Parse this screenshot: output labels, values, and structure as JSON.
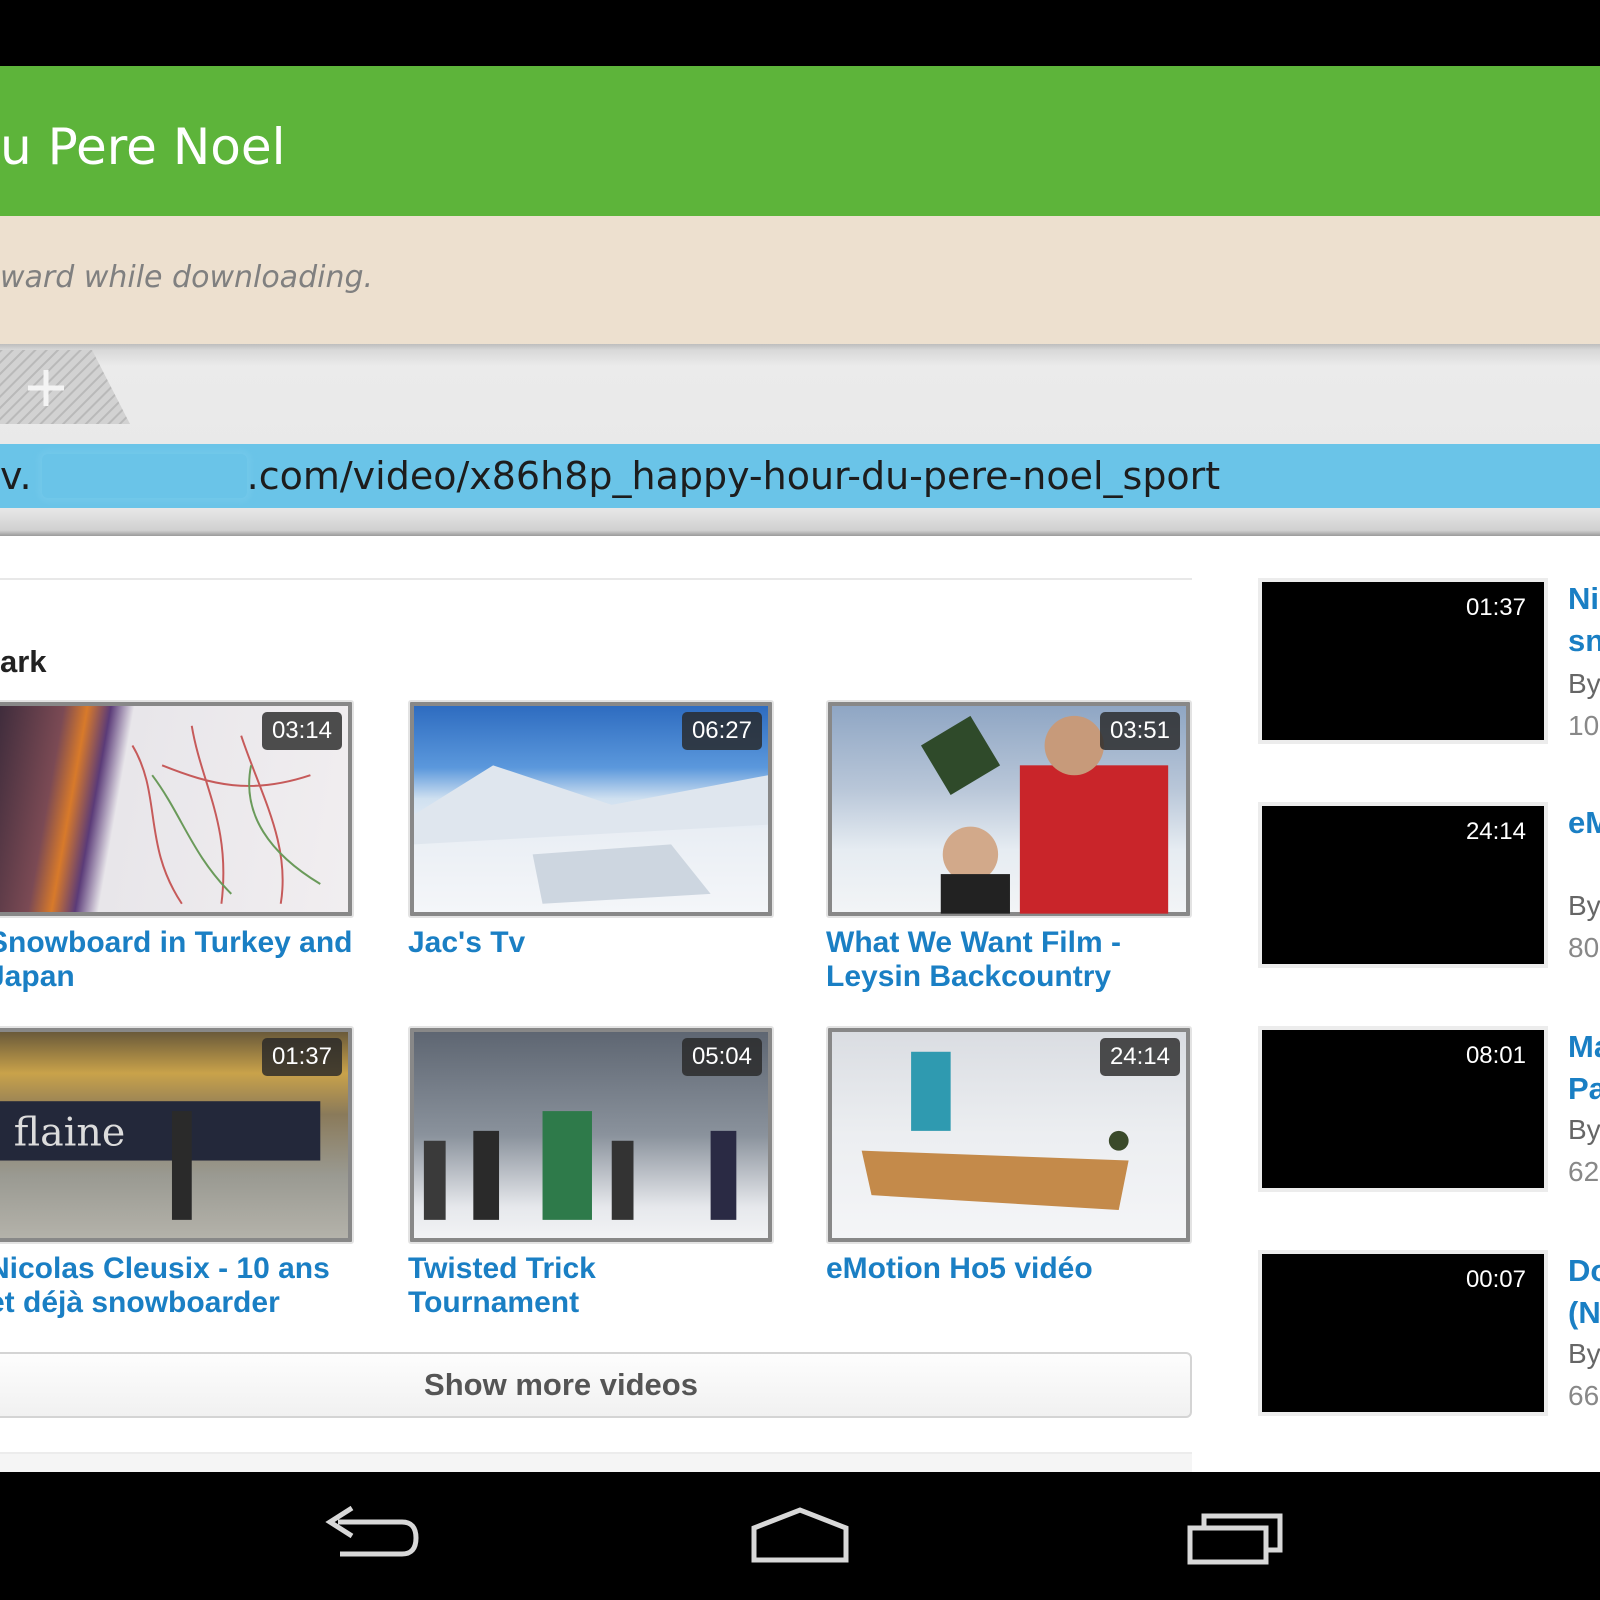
{
  "app_bar": {
    "title": "u Pere Noel"
  },
  "notice": {
    "text": "ward while downloading."
  },
  "url_bar": {
    "prefix": "v.",
    "path": ".com/video/x86h8p_happy-hour-du-pere-noel_sport"
  },
  "section": {
    "title": "ark"
  },
  "grid_videos": [
    {
      "title": "Snowboard in Turkey and Japan",
      "duration": "03:14"
    },
    {
      "title": "Jac's Tv",
      "duration": "06:27"
    },
    {
      "title": "What We Want Film - Leysin Backcountry",
      "duration": "03:51"
    },
    {
      "title": "Nicolas Cleusix - 10 ans et déjà snowboarder",
      "duration": "01:37"
    },
    {
      "title": "Twisted Trick Tournament",
      "duration": "05:04"
    },
    {
      "title": "eMotion Ho5 vidéo",
      "duration": "24:14"
    }
  ],
  "show_more_label": "Show more videos",
  "side_videos": [
    {
      "duration": "01:37",
      "title_line1": "Ni",
      "title_line2": "sn",
      "by": "By",
      "views": "10"
    },
    {
      "duration": "24:14",
      "title_line1": "eM",
      "title_line2": "",
      "by": "By",
      "views": "80"
    },
    {
      "duration": "08:01",
      "title_line1": "Ma",
      "title_line2": "Pa",
      "by": "By",
      "views": "62"
    },
    {
      "duration": "00:07",
      "title_line1": "Do",
      "title_line2": "(N",
      "by": "By",
      "views": "66"
    }
  ],
  "nav_icons": [
    "back-icon",
    "home-icon",
    "recent-apps-icon"
  ],
  "colors": {
    "app_bar": "#5db43a",
    "notice": "#ede0cf",
    "url_bar": "#6ac4e8",
    "link": "#1a7fc4"
  }
}
